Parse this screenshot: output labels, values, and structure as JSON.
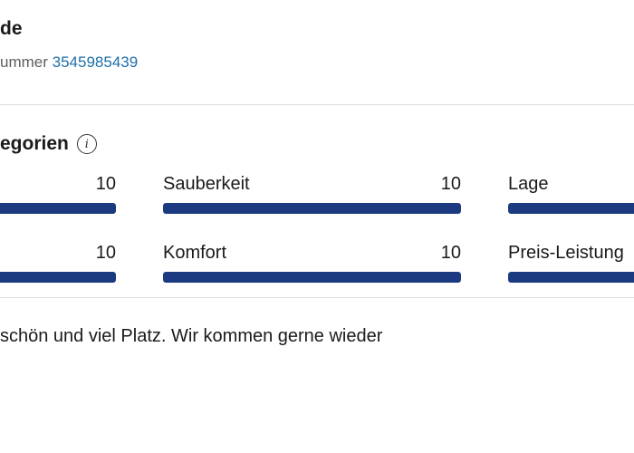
{
  "header": {
    "title_fragment": "de",
    "booking_label": "ummer",
    "booking_number": "3545985439"
  },
  "categories": {
    "title": "egorien",
    "info_icon": "info-icon"
  },
  "scores": [
    {
      "label": "",
      "value": "10",
      "fraction": 1.0
    },
    {
      "label": "Sauberkeit",
      "value": "10",
      "fraction": 1.0
    },
    {
      "label": "Lage",
      "value": "",
      "fraction": 1.0
    },
    {
      "label": "",
      "value": "10",
      "fraction": 1.0
    },
    {
      "label": "Komfort",
      "value": "10",
      "fraction": 1.0
    },
    {
      "label": "Preis-Leistung",
      "value": "",
      "fraction": 1.0
    }
  ],
  "review": {
    "text": "schön und viel Platz. Wir kommen gerne wieder"
  },
  "colors": {
    "bar_fill": "#1c3a80",
    "bar_track": "#e7e7e7",
    "link": "#1f6fa8",
    "divider": "#dedede"
  }
}
